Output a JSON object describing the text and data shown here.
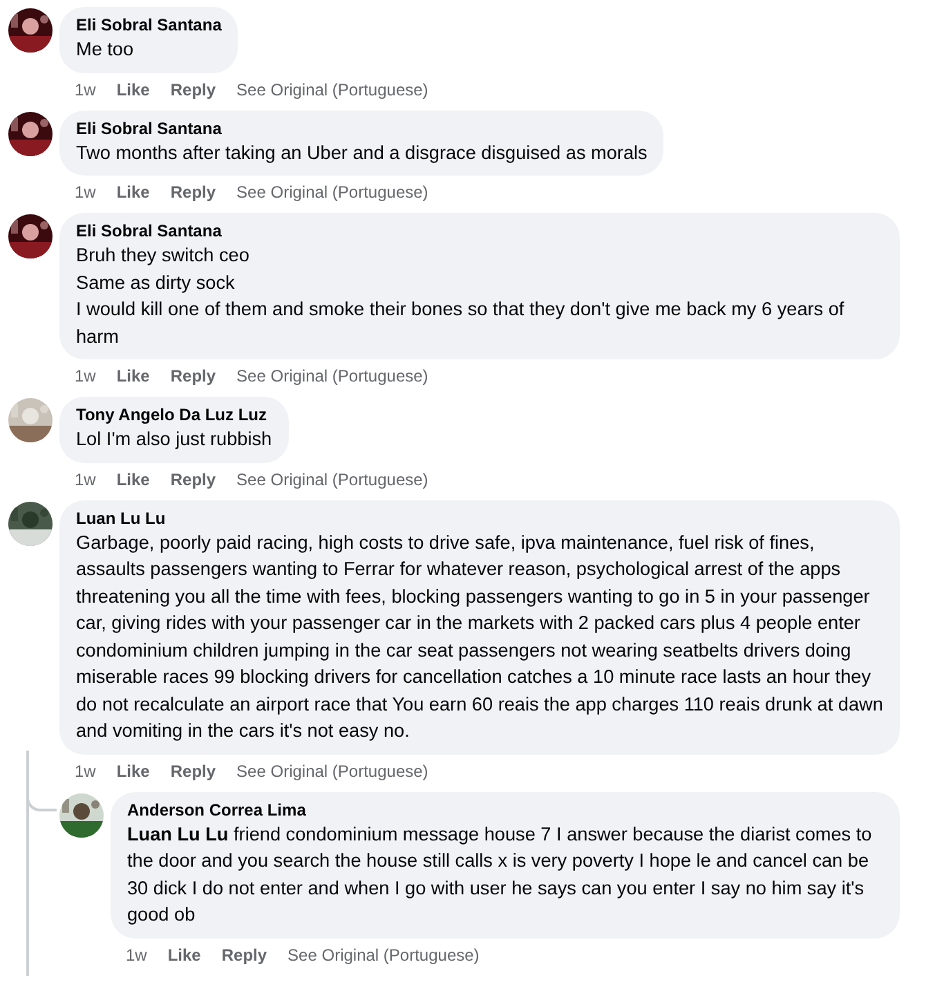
{
  "comments": [
    {
      "author": "Eli Sobral Santana",
      "lines": [
        "Me too"
      ],
      "time": "1w",
      "actions": [
        "Like",
        "Reply",
        "See Original (Portuguese)"
      ]
    },
    {
      "author": "Eli Sobral Santana",
      "lines": [
        "Two months after taking an Uber and a disgrace disguised as morals"
      ],
      "time": "1w",
      "actions": [
        "Like",
        "Reply",
        "See Original (Portuguese)"
      ]
    },
    {
      "author": "Eli Sobral Santana",
      "lines": [
        "Bruh they switch ceo",
        "Same as dirty sock",
        "I would kill one of them and smoke their bones so that they don't give me back my 6 years of harm"
      ],
      "time": "1w",
      "actions": [
        "Like",
        "Reply",
        "See Original (Portuguese)"
      ]
    },
    {
      "author": "Tony Angelo Da Luz Luz",
      "lines": [
        "Lol I'm also just rubbish"
      ],
      "time": "1w",
      "actions": [
        "Like",
        "Reply",
        "See Original (Portuguese)"
      ]
    },
    {
      "author": "Luan Lu Lu",
      "lines": [
        "Garbage, poorly paid racing, high costs to drive safe, ipva maintenance, fuel risk of fines, assaults passengers wanting to Ferrar for whatever reason, psychological arrest of the apps threatening you all the time with fees, blocking passengers wanting to go in 5 in your passenger car, giving rides with your passenger car in the markets with 2 packed cars plus 4 people enter condominium children jumping in the car seat passengers not wearing seatbelts drivers doing miserable races 99 blocking drivers for cancellation catches a 10 minute race lasts an hour they do not recalculate an airport race that You earn 60 reais the app charges 110 reais drunk at dawn and vomiting in the cars it's not easy no."
      ],
      "time": "1w",
      "actions": [
        "Like",
        "Reply",
        "See Original (Portuguese)"
      ],
      "replies": [
        {
          "author": "Anderson Correa Lima",
          "lines": [
            "**Luan Lu Lu** friend condominium message house 7 I answer because the diarist comes to the door and you search the house still calls x is very poverty I hope le and cancel can be 30 dick I do not enter and when I go with user he says can you enter I say no him say it's good ob"
          ],
          "time": "1w",
          "actions": [
            "Like",
            "Reply",
            "See Original (Portuguese)"
          ]
        }
      ]
    }
  ]
}
